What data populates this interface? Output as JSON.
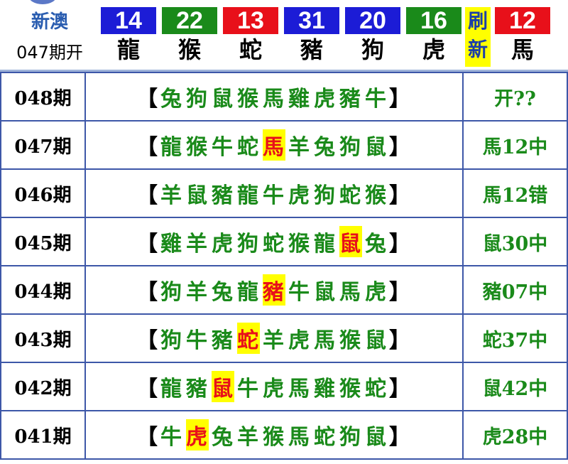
{
  "header": {
    "brand": "新澳",
    "period_open": "047期开",
    "balls": [
      {
        "number": "14",
        "zodiac": "龍",
        "color": "#1c1cd6"
      },
      {
        "number": "22",
        "zodiac": "猴",
        "color": "#1a8a1a"
      },
      {
        "number": "13",
        "zodiac": "蛇",
        "color": "#e8101a"
      },
      {
        "number": "31",
        "zodiac": "豬",
        "color": "#1c1cd6"
      },
      {
        "number": "20",
        "zodiac": "狗",
        "color": "#1c1cd6"
      },
      {
        "number": "16",
        "zodiac": "虎",
        "color": "#1a8a1a"
      },
      {
        "number": "12",
        "zodiac": "馬",
        "color": "#e8101a"
      }
    ],
    "refresh": [
      "刷",
      "新"
    ]
  },
  "rows": [
    {
      "period": "048期",
      "zodiacs": [
        "兔",
        "狗",
        "鼠",
        "猴",
        "馬",
        "雞",
        "虎",
        "豬",
        "牛"
      ],
      "hit": null,
      "result": "开??"
    },
    {
      "period": "047期",
      "zodiacs": [
        "龍",
        "猴",
        "牛",
        "蛇",
        "馬",
        "羊",
        "兔",
        "狗",
        "鼠"
      ],
      "hit": 4,
      "result": "馬12中"
    },
    {
      "period": "046期",
      "zodiacs": [
        "羊",
        "鼠",
        "豬",
        "龍",
        "牛",
        "虎",
        "狗",
        "蛇",
        "猴"
      ],
      "hit": null,
      "result": "馬12错"
    },
    {
      "period": "045期",
      "zodiacs": [
        "雞",
        "羊",
        "虎",
        "狗",
        "蛇",
        "猴",
        "龍",
        "鼠",
        "兔"
      ],
      "hit": 7,
      "result": "鼠30中"
    },
    {
      "period": "044期",
      "zodiacs": [
        "狗",
        "羊",
        "兔",
        "龍",
        "豬",
        "牛",
        "鼠",
        "馬",
        "虎"
      ],
      "hit": 4,
      "result": "豬07中"
    },
    {
      "period": "043期",
      "zodiacs": [
        "狗",
        "牛",
        "豬",
        "蛇",
        "羊",
        "虎",
        "馬",
        "猴",
        "鼠"
      ],
      "hit": 3,
      "result": "蛇37中"
    },
    {
      "period": "042期",
      "zodiacs": [
        "龍",
        "豬",
        "鼠",
        "牛",
        "虎",
        "馬",
        "雞",
        "猴",
        "蛇"
      ],
      "hit": 2,
      "result": "鼠42中"
    },
    {
      "period": "041期",
      "zodiacs": [
        "牛",
        "虎",
        "兔",
        "羊",
        "猴",
        "馬",
        "蛇",
        "狗",
        "鼠"
      ],
      "hit": 1,
      "result": "虎28中"
    }
  ],
  "brackets": {
    "open": "【",
    "close": "】"
  }
}
